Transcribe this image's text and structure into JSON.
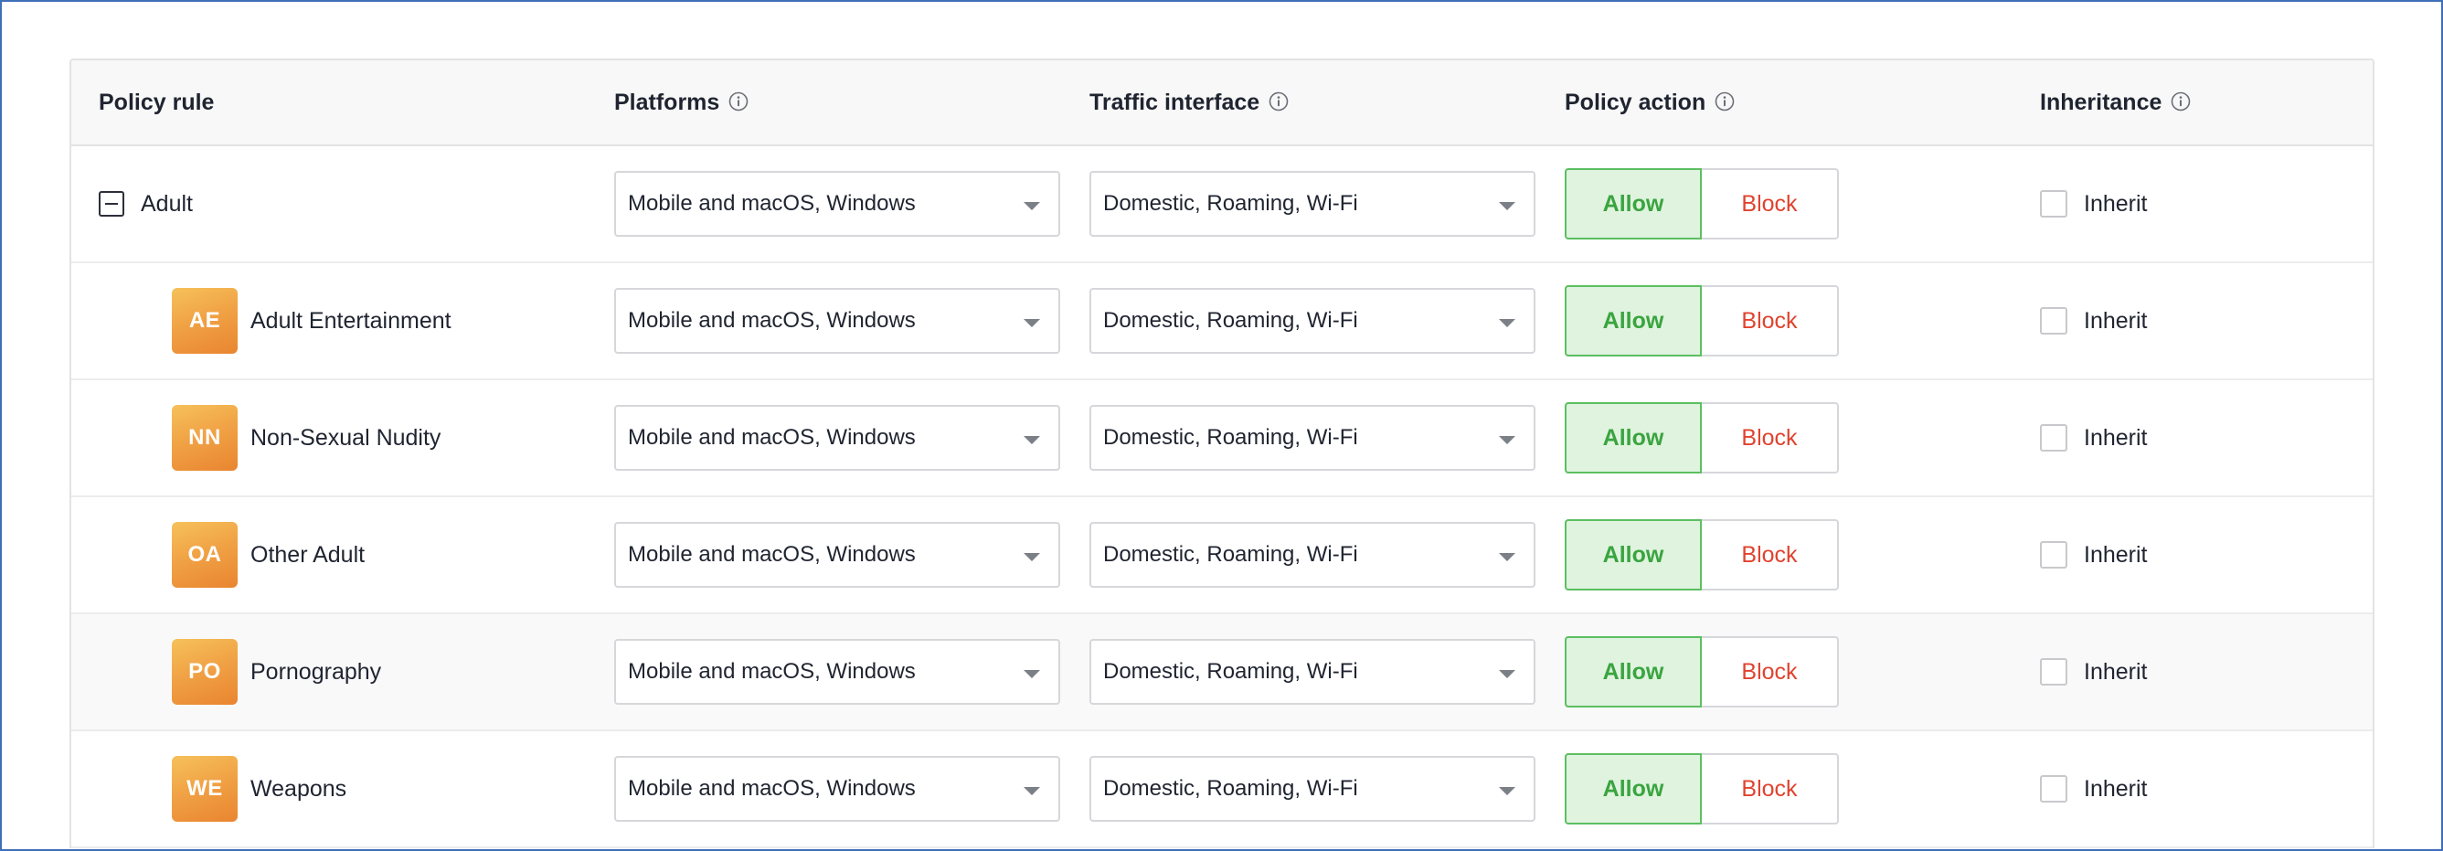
{
  "header": {
    "policy_rule": "Policy rule",
    "platforms": "Platforms",
    "traffic_interface": "Traffic interface",
    "policy_action": "Policy action",
    "inheritance": "Inheritance"
  },
  "colors": {
    "allow_text": "#3aa43f",
    "allow_bg": "#dff3df",
    "block_text": "#e0432f",
    "badge_orange": "#f0a044",
    "frame_blue": "#3f6fb8"
  },
  "icons": {
    "info": "info-circle-icon",
    "collapse": "minus-square-icon",
    "dropdown": "caret-down-icon"
  },
  "rows": [
    {
      "badge": "",
      "label": "Adult",
      "platforms": "Mobile and macOS, Windows",
      "traffic": "Domestic, Roaming, Wi-Fi",
      "allow": "Allow",
      "block": "Block",
      "inherit": "Inherit"
    },
    {
      "badge": "AE",
      "label": "Adult Entertainment",
      "platforms": "Mobile and macOS, Windows",
      "traffic": "Domestic, Roaming, Wi-Fi",
      "allow": "Allow",
      "block": "Block",
      "inherit": "Inherit"
    },
    {
      "badge": "NN",
      "label": "Non-Sexual Nudity",
      "platforms": "Mobile and macOS, Windows",
      "traffic": "Domestic, Roaming, Wi-Fi",
      "allow": "Allow",
      "block": "Block",
      "inherit": "Inherit"
    },
    {
      "badge": "OA",
      "label": "Other Adult",
      "platforms": "Mobile and macOS, Windows",
      "traffic": "Domestic, Roaming, Wi-Fi",
      "allow": "Allow",
      "block": "Block",
      "inherit": "Inherit"
    },
    {
      "badge": "PO",
      "label": "Pornography",
      "platforms": "Mobile and macOS, Windows",
      "traffic": "Domestic, Roaming, Wi-Fi",
      "allow": "Allow",
      "block": "Block",
      "inherit": "Inherit"
    },
    {
      "badge": "WE",
      "label": "Weapons",
      "platforms": "Mobile and macOS, Windows",
      "traffic": "Domestic, Roaming, Wi-Fi",
      "allow": "Allow",
      "block": "Block",
      "inherit": "Inherit"
    }
  ]
}
